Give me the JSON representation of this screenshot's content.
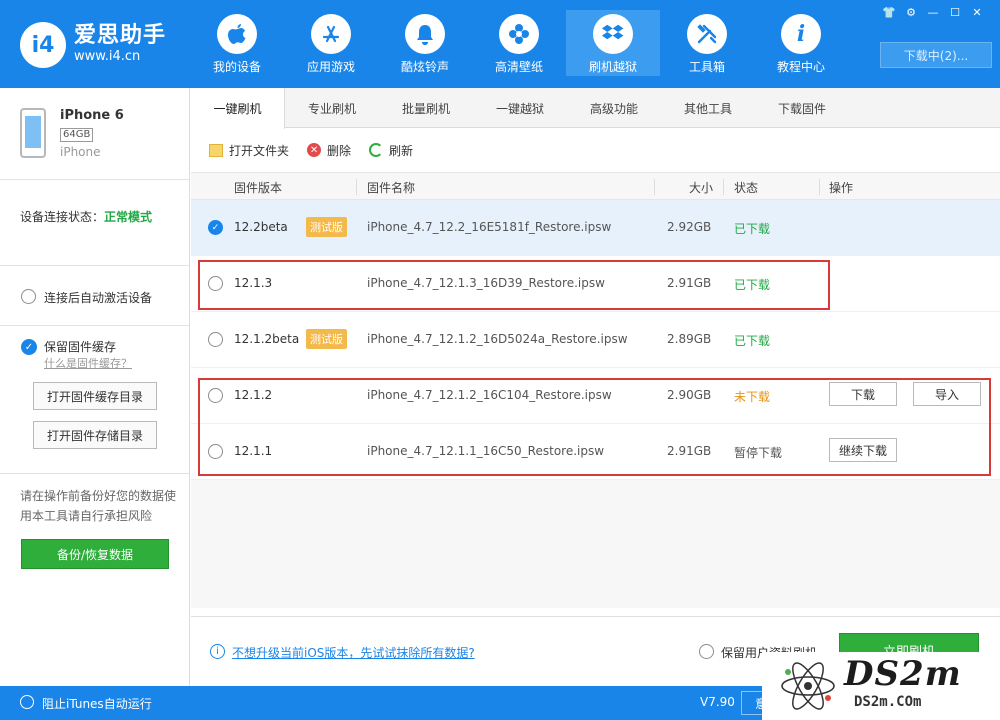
{
  "app": {
    "logo_badge": "i4",
    "logo_name": "爱思助手",
    "logo_url": "www.i4.cn",
    "download_status": "下载中(2)..."
  },
  "nav": [
    {
      "label": "我的设备",
      "icon": "apple-icon"
    },
    {
      "label": "应用游戏",
      "icon": "appstore-icon"
    },
    {
      "label": "酷炫铃声",
      "icon": "bell-icon"
    },
    {
      "label": "高清壁纸",
      "icon": "flower-icon"
    },
    {
      "label": "刷机越狱",
      "icon": "dropbox-icon"
    },
    {
      "label": "工具箱",
      "icon": "tools-icon"
    },
    {
      "label": "教程中心",
      "icon": "info-icon"
    }
  ],
  "window_controls": [
    "shirt-icon",
    "gear-icon",
    "minimize-icon",
    "maximize-icon",
    "close-icon"
  ],
  "device": {
    "name": "iPhone 6",
    "capacity": "64GB",
    "model": "iPhone"
  },
  "sidebar": {
    "conn_label": "设备连接状态：",
    "conn_mode": "正常模式",
    "auto_activate": "连接后自动激活设备",
    "keep_cache": "保留固件缓存",
    "cache_link": "什么是固件缓存？",
    "open_cache_dir": "打开固件缓存目录",
    "open_store_dir": "打开固件存储目录",
    "warning": "请在操作前备份好您的数据使用本工具请自行承担风险",
    "backup_button": "备份/恢复数据"
  },
  "tabs": [
    "一键刷机",
    "专业刷机",
    "批量刷机",
    "一键越狱",
    "高级功能",
    "其他工具",
    "下载固件"
  ],
  "toolbar": {
    "open_folder": "打开文件夹",
    "delete": "删除",
    "refresh": "刷新"
  },
  "table": {
    "headers": {
      "version": "固件版本",
      "name": "固件名称",
      "size": "大小",
      "status": "状态",
      "action": "操作"
    },
    "rows": [
      {
        "version": "12.2beta",
        "beta": "测试版",
        "name": "iPhone_4.7_12.2_16E5181f_Restore.ipsw",
        "size": "2.92GB",
        "status": "已下载",
        "status_type": "ok",
        "selected": true
      },
      {
        "version": "12.1.3",
        "beta": "",
        "name": "iPhone_4.7_12.1.3_16D39_Restore.ipsw",
        "size": "2.91GB",
        "status": "已下载",
        "status_type": "ok",
        "selected": false
      },
      {
        "version": "12.1.2beta",
        "beta": "测试版",
        "name": "iPhone_4.7_12.1.2_16D5024a_Restore.ipsw",
        "size": "2.89GB",
        "status": "已下载",
        "status_type": "ok",
        "selected": false
      },
      {
        "version": "12.1.2",
        "beta": "",
        "name": "iPhone_4.7_12.1.2_16C104_Restore.ipsw",
        "size": "2.90GB",
        "status": "未下载",
        "status_type": "no",
        "selected": false,
        "actions": [
          "下载",
          "导入"
        ]
      },
      {
        "version": "12.1.1",
        "beta": "",
        "name": "iPhone_4.7_12.1.1_16C50_Restore.ipsw",
        "size": "2.91GB",
        "status": "暂停下载",
        "status_type": "pause",
        "selected": false,
        "actions": [
          "继续下载"
        ]
      }
    ]
  },
  "bottom": {
    "link": "不想升级当前iOS版本，先试试抹除所有数据?",
    "keep_user_data": "保留用户资料刷机",
    "flash_button": "立即刷机"
  },
  "statusbar": {
    "itunes": "阻止iTunes自动运行",
    "version": "V7.90",
    "btn": "意"
  },
  "watermark": {
    "text": "DS2m",
    "sub": "DS2m.COm"
  },
  "colors": {
    "brand_blue": "#1a85e8",
    "success_green": "#22a845",
    "warning_orange": "#e8920f",
    "highlight_red": "#d83a3a",
    "beta_badge": "#f3b94a"
  }
}
